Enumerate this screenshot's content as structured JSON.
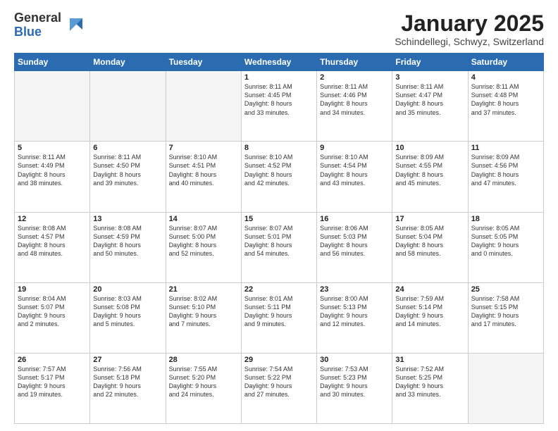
{
  "header": {
    "logo_general": "General",
    "logo_blue": "Blue",
    "month_title": "January 2025",
    "location": "Schindellegi, Schwyz, Switzerland"
  },
  "weekdays": [
    "Sunday",
    "Monday",
    "Tuesday",
    "Wednesday",
    "Thursday",
    "Friday",
    "Saturday"
  ],
  "weeks": [
    [
      {
        "day": "",
        "info": ""
      },
      {
        "day": "",
        "info": ""
      },
      {
        "day": "",
        "info": ""
      },
      {
        "day": "1",
        "info": "Sunrise: 8:11 AM\nSunset: 4:45 PM\nDaylight: 8 hours\nand 33 minutes."
      },
      {
        "day": "2",
        "info": "Sunrise: 8:11 AM\nSunset: 4:46 PM\nDaylight: 8 hours\nand 34 minutes."
      },
      {
        "day": "3",
        "info": "Sunrise: 8:11 AM\nSunset: 4:47 PM\nDaylight: 8 hours\nand 35 minutes."
      },
      {
        "day": "4",
        "info": "Sunrise: 8:11 AM\nSunset: 4:48 PM\nDaylight: 8 hours\nand 37 minutes."
      }
    ],
    [
      {
        "day": "5",
        "info": "Sunrise: 8:11 AM\nSunset: 4:49 PM\nDaylight: 8 hours\nand 38 minutes."
      },
      {
        "day": "6",
        "info": "Sunrise: 8:11 AM\nSunset: 4:50 PM\nDaylight: 8 hours\nand 39 minutes."
      },
      {
        "day": "7",
        "info": "Sunrise: 8:10 AM\nSunset: 4:51 PM\nDaylight: 8 hours\nand 40 minutes."
      },
      {
        "day": "8",
        "info": "Sunrise: 8:10 AM\nSunset: 4:52 PM\nDaylight: 8 hours\nand 42 minutes."
      },
      {
        "day": "9",
        "info": "Sunrise: 8:10 AM\nSunset: 4:54 PM\nDaylight: 8 hours\nand 43 minutes."
      },
      {
        "day": "10",
        "info": "Sunrise: 8:09 AM\nSunset: 4:55 PM\nDaylight: 8 hours\nand 45 minutes."
      },
      {
        "day": "11",
        "info": "Sunrise: 8:09 AM\nSunset: 4:56 PM\nDaylight: 8 hours\nand 47 minutes."
      }
    ],
    [
      {
        "day": "12",
        "info": "Sunrise: 8:08 AM\nSunset: 4:57 PM\nDaylight: 8 hours\nand 48 minutes."
      },
      {
        "day": "13",
        "info": "Sunrise: 8:08 AM\nSunset: 4:59 PM\nDaylight: 8 hours\nand 50 minutes."
      },
      {
        "day": "14",
        "info": "Sunrise: 8:07 AM\nSunset: 5:00 PM\nDaylight: 8 hours\nand 52 minutes."
      },
      {
        "day": "15",
        "info": "Sunrise: 8:07 AM\nSunset: 5:01 PM\nDaylight: 8 hours\nand 54 minutes."
      },
      {
        "day": "16",
        "info": "Sunrise: 8:06 AM\nSunset: 5:03 PM\nDaylight: 8 hours\nand 56 minutes."
      },
      {
        "day": "17",
        "info": "Sunrise: 8:05 AM\nSunset: 5:04 PM\nDaylight: 8 hours\nand 58 minutes."
      },
      {
        "day": "18",
        "info": "Sunrise: 8:05 AM\nSunset: 5:05 PM\nDaylight: 9 hours\nand 0 minutes."
      }
    ],
    [
      {
        "day": "19",
        "info": "Sunrise: 8:04 AM\nSunset: 5:07 PM\nDaylight: 9 hours\nand 2 minutes."
      },
      {
        "day": "20",
        "info": "Sunrise: 8:03 AM\nSunset: 5:08 PM\nDaylight: 9 hours\nand 5 minutes."
      },
      {
        "day": "21",
        "info": "Sunrise: 8:02 AM\nSunset: 5:10 PM\nDaylight: 9 hours\nand 7 minutes."
      },
      {
        "day": "22",
        "info": "Sunrise: 8:01 AM\nSunset: 5:11 PM\nDaylight: 9 hours\nand 9 minutes."
      },
      {
        "day": "23",
        "info": "Sunrise: 8:00 AM\nSunset: 5:13 PM\nDaylight: 9 hours\nand 12 minutes."
      },
      {
        "day": "24",
        "info": "Sunrise: 7:59 AM\nSunset: 5:14 PM\nDaylight: 9 hours\nand 14 minutes."
      },
      {
        "day": "25",
        "info": "Sunrise: 7:58 AM\nSunset: 5:15 PM\nDaylight: 9 hours\nand 17 minutes."
      }
    ],
    [
      {
        "day": "26",
        "info": "Sunrise: 7:57 AM\nSunset: 5:17 PM\nDaylight: 9 hours\nand 19 minutes."
      },
      {
        "day": "27",
        "info": "Sunrise: 7:56 AM\nSunset: 5:18 PM\nDaylight: 9 hours\nand 22 minutes."
      },
      {
        "day": "28",
        "info": "Sunrise: 7:55 AM\nSunset: 5:20 PM\nDaylight: 9 hours\nand 24 minutes."
      },
      {
        "day": "29",
        "info": "Sunrise: 7:54 AM\nSunset: 5:22 PM\nDaylight: 9 hours\nand 27 minutes."
      },
      {
        "day": "30",
        "info": "Sunrise: 7:53 AM\nSunset: 5:23 PM\nDaylight: 9 hours\nand 30 minutes."
      },
      {
        "day": "31",
        "info": "Sunrise: 7:52 AM\nSunset: 5:25 PM\nDaylight: 9 hours\nand 33 minutes."
      },
      {
        "day": "",
        "info": ""
      }
    ]
  ]
}
